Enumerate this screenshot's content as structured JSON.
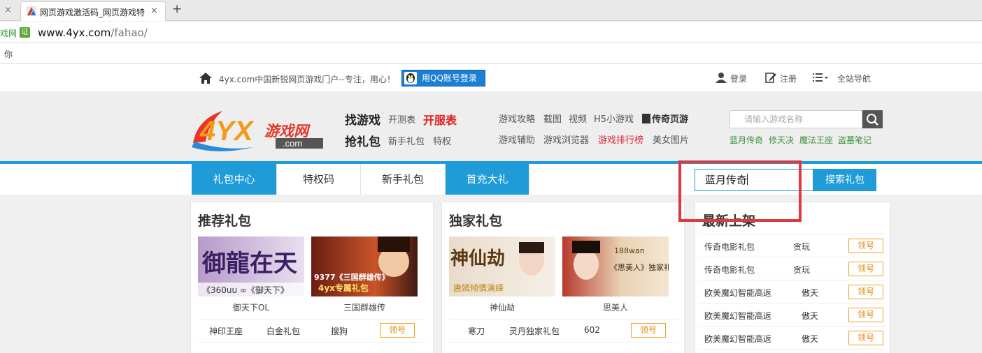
{
  "browser": {
    "prev_tab_close": "×",
    "active_tab_title": "网页游戏激活码_网页游戏特",
    "active_tab_close": "×",
    "new_tab": "+",
    "site_label": "戏网",
    "cert_badge": "证",
    "url_host": "www.4yx.com",
    "url_path": "/fahao/",
    "bookmark": "你"
  },
  "topbar": {
    "slogan": "4yx.com中国新锐网页游戏门户--专注，用心！",
    "qq_login": "用QQ账号登录",
    "login": "登录",
    "register": "注册",
    "site_nav": "全站导航"
  },
  "header": {
    "logo_main": "4YX",
    "logo_cn": "游戏网",
    "logo_com": ".com",
    "find_game": "找游戏",
    "test_list": "开测表",
    "server_list": "开服表",
    "grab_gift": "抢礼包",
    "newbie_gift": "新手礼包",
    "privilege": "特权",
    "links_row1": [
      "游戏攻略",
      "截图",
      "视频",
      "H5小游戏",
      "传奇页游"
    ],
    "links_row2": [
      "游戏辅助",
      "游戏浏览器",
      "游戏排行榜",
      "美女图片"
    ],
    "search_placeholder": "请输入游戏名称",
    "hot_games": [
      "蓝月传奇",
      "修天决",
      "魔法王座",
      "盗墓笔记"
    ]
  },
  "gift_tabs": {
    "tabs": [
      "礼包中心",
      "特权码",
      "新手礼包",
      "首充大礼"
    ],
    "search_value": "蓝月传奇",
    "search_button": "搜索礼包"
  },
  "recommend": {
    "title": "推荐礼包",
    "items": [
      {
        "caption": "御天下OL",
        "art": "御龍在天",
        "art_sub": "《360uu ∞《御天下》"
      },
      {
        "caption": "三国群雄传",
        "art": "9377《三国群雄传》",
        "art_sub": "4yx专属礼包"
      }
    ],
    "rows": [
      {
        "game": "神印王座",
        "gift": "白金礼包",
        "platform": "搜狗",
        "button": "领号"
      }
    ]
  },
  "exclusive": {
    "title": "独家礼包",
    "items": [
      {
        "caption": "神仙劫",
        "art": "神仙劫",
        "art_sub": "唐嫣倾情演绎"
      },
      {
        "caption": "思美人",
        "art": "188wan",
        "art_sub": "《思美人》独家礼包"
      }
    ],
    "rows": [
      {
        "game": "寒刀",
        "gift": "灵丹独家礼包",
        "count": "602",
        "button": "领号"
      }
    ]
  },
  "new_arrivals": {
    "title": "最新上架",
    "rows": [
      {
        "name": "传奇电影礼包",
        "platform": "贪玩",
        "button": "领号"
      },
      {
        "name": "传奇电影礼包",
        "platform": "贪玩",
        "button": "领号"
      },
      {
        "name": "欧美魔幻智能高返",
        "platform": "傲天",
        "button": "领号"
      },
      {
        "name": "欧美魔幻智能高返",
        "platform": "傲天",
        "button": "领号"
      },
      {
        "name": "欧美魔幻智能高返",
        "platform": "傲天",
        "button": "领号"
      }
    ]
  },
  "colors": {
    "accent_blue": "#1f9bd7",
    "highlight_red": "#e0383f",
    "claim_orange": "#f0a020"
  }
}
